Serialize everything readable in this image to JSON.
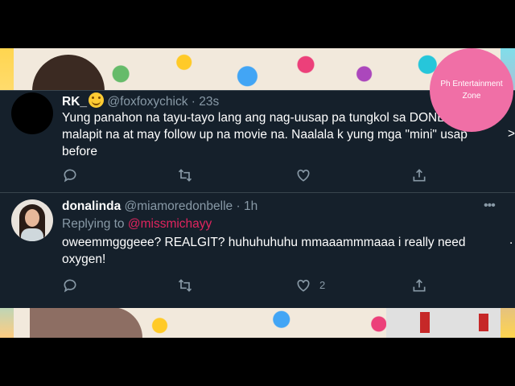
{
  "watermark": {
    "text": "Ph Entertainment Zone"
  },
  "tweet1": {
    "display_name": "RK_",
    "emoji": "smiling-face-emoji",
    "handle": "@foxfoxychick",
    "separator": "·",
    "time": "23s",
    "text": "Yung panahon na tayu-tayo lang ang nag-uusap pa tungkol sa DONB ngayon malapit na at may follow up na movie na. Naalala k yung mga \"mini\" usap before"
  },
  "tweet2": {
    "display_name": "donalinda",
    "handle": "@miamoredonbelle",
    "separator": "·",
    "time": "1h",
    "reply_label": "Replying to",
    "reply_mention": "@missmichayy",
    "text": "oweemmgggeee? REALGIT? huhuhuhuhu mmaaammmaaa i really need oxygen!",
    "like_count": "2",
    "more_icon": "•••"
  },
  "edge_fragments": {
    "tweet1_right": ">",
    "tweet2_right": "."
  },
  "icons": [
    "reply-icon",
    "retweet-icon",
    "like-icon",
    "share-icon",
    "more-icon"
  ],
  "colors": {
    "background": "#15202b",
    "secondary_text": "#8899a6",
    "mention": "#e0245e",
    "watermark": "#f06fa6"
  }
}
